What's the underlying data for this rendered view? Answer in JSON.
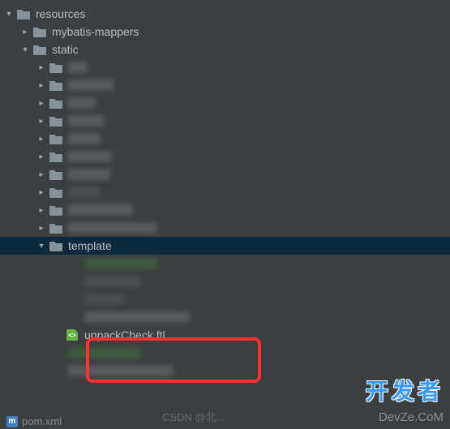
{
  "tree": {
    "resources": "resources",
    "mybatis_mappers": "mybatis-mappers",
    "static": "static",
    "template": "template",
    "unpack_check": "unpackCheck.ftl",
    "pom": "pom.xml"
  },
  "watermark": {
    "cn": "开发者",
    "domain": "DevZe.CoM",
    "csdn": "CSDN @北..."
  }
}
